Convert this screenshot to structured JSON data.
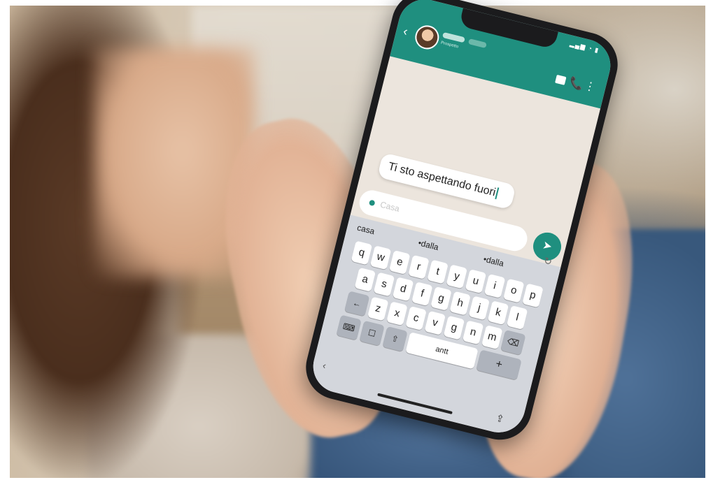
{
  "colors": {
    "accent": "#1f8f7f",
    "chat_bg": "#ece5dd"
  },
  "status": {
    "icons": "▂▄▆ ◔ ▮"
  },
  "header": {
    "back_icon": "‹",
    "contact_status": "Prospetto",
    "call_icon": "📞",
    "more_icon": "⋮"
  },
  "chat": {
    "message": "Ti sto aspettando fuori"
  },
  "input": {
    "placeholder": "Casa",
    "send_icon": "➤"
  },
  "keyboard": {
    "suggestions": [
      "casa",
      "•dalla",
      "•dalla"
    ],
    "row1": [
      "q",
      "w",
      "e",
      "r",
      "t",
      "y",
      "u",
      "i",
      "o",
      "p"
    ],
    "row2": [
      "a",
      "s",
      "d",
      "f",
      "g",
      "h",
      "j",
      "k",
      "l"
    ],
    "row3": [
      "←",
      "z",
      "x",
      "c",
      "v",
      "g",
      "n",
      "m",
      "⌫"
    ],
    "row4_left": [
      "⌨",
      "☐",
      "⇧"
    ],
    "space_label": "antt",
    "enter_label": "+",
    "share_icon": "⇪",
    "nav_back": "‹"
  }
}
